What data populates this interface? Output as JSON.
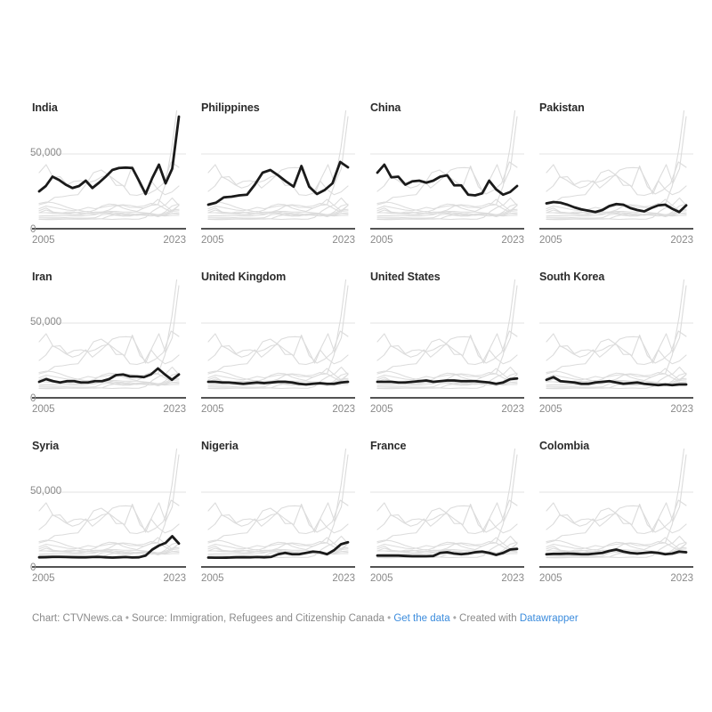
{
  "footer": {
    "chart_credit": "Chart: CTVNews.ca",
    "sep1": "•",
    "source": "Source: Immigration, Refugees and Citizenship Canada",
    "sep2": "•",
    "get_data_link": "Get the data",
    "sep3": "•",
    "created_with_prefix": "Created with",
    "created_with_link": "Datawrapper"
  },
  "axis": {
    "y_ticks": [
      "50,000",
      "0"
    ],
    "x_tick_left": "2005",
    "x_tick_right": "2023"
  },
  "colors": {
    "highlight_line": "#1a1a1a",
    "context_line": "#dcdcdc",
    "gridline": "#e3e3e3",
    "axis_line": "#1a1a1a",
    "tick_text": "#8a8a8a",
    "title_text": "#2b2b2b",
    "link": "#3b8cdd",
    "background": "#ffffff"
  },
  "chart_data": {
    "type": "line",
    "title": "",
    "subtitle": "",
    "xlabel": "",
    "ylabel": "",
    "grid": true,
    "legend_position": "none",
    "layout": "small-multiples 4 x 3",
    "ylim": [
      0,
      78000
    ],
    "y_tick_values": [
      0,
      50000
    ],
    "xlim": [
      2003,
      2023
    ],
    "x_tick_values": [
      2005,
      2023
    ],
    "x": [
      2003,
      2004,
      2005,
      2006,
      2007,
      2008,
      2009,
      2010,
      2011,
      2012,
      2013,
      2014,
      2015,
      2016,
      2017,
      2018,
      2019,
      2020,
      2021,
      2022,
      2023
    ],
    "panels": [
      {
        "name": "India",
        "row": 0,
        "col": 0,
        "values": [
          22000,
          26000,
          33000,
          30500,
          27000,
          24500,
          26000,
          30000,
          24500,
          28500,
          33000,
          38000,
          39500,
          39800,
          39500,
          30000,
          20000,
          32000,
          42000,
          28000,
          39000,
          78000
        ]
      },
      {
        "name": "Philippines",
        "row": 0,
        "col": 1,
        "values": [
          12000,
          13500,
          17500,
          18000,
          19000,
          19500,
          27000,
          36000,
          38000,
          34000,
          29500,
          25500,
          41000,
          25500,
          20000,
          23000,
          28000,
          44000,
          40000
        ]
      },
      {
        "name": "China",
        "row": 0,
        "col": 2,
        "values": [
          36000,
          42000,
          32500,
          33000,
          27000,
          29500,
          30000,
          28500,
          30000,
          33000,
          34000,
          26500,
          26500,
          19500,
          19000,
          20500,
          30000,
          23500,
          19500,
          21500,
          26000
        ]
      },
      {
        "name": "Pakistan",
        "row": 0,
        "col": 3,
        "values": [
          13000,
          14000,
          13500,
          12000,
          10000,
          8500,
          7500,
          6500,
          8000,
          11000,
          12500,
          12000,
          9500,
          8000,
          7000,
          9500,
          11500,
          12000,
          9000,
          6500,
          11500
        ]
      },
      {
        "name": "Iran",
        "row": 1,
        "col": 0,
        "values": [
          6000,
          8000,
          6500,
          5500,
          6500,
          6500,
          5500,
          5500,
          6500,
          6500,
          8000,
          11000,
          11500,
          10000,
          10000,
          9500,
          11500,
          16000,
          11500,
          7500,
          11500
        ]
      },
      {
        "name": "United Kingdom",
        "row": 1,
        "col": 1,
        "values": [
          6000,
          6000,
          5500,
          5500,
          5000,
          4500,
          5000,
          5500,
          5000,
          5500,
          6000,
          6000,
          5500,
          4500,
          4000,
          4500,
          5000,
          4500,
          4500,
          5500,
          6000
        ]
      },
      {
        "name": "United States",
        "row": 1,
        "col": 2,
        "values": [
          6000,
          6000,
          6000,
          5500,
          5500,
          6000,
          6500,
          7000,
          6000,
          6500,
          7000,
          7000,
          6500,
          6500,
          6500,
          6000,
          5500,
          4500,
          5500,
          8000,
          8500
        ]
      },
      {
        "name": "South Korea",
        "row": 1,
        "col": 3,
        "values": [
          7500,
          9500,
          6500,
          6000,
          5500,
          4500,
          4500,
          5500,
          6000,
          6500,
          5500,
          4500,
          5000,
          5500,
          4500,
          4000,
          3500,
          4000,
          3500,
          4000,
          4000
        ]
      },
      {
        "name": "Syria",
        "row": 2,
        "col": 0,
        "values": [
          1200,
          1300,
          1500,
          1500,
          1400,
          1300,
          1200,
          1200,
          1400,
          1500,
          1200,
          1000,
          1200,
          1400,
          1100,
          1200,
          2500,
          7000,
          10000,
          12000,
          17000,
          11500
        ]
      },
      {
        "name": "Nigeria",
        "row": 2,
        "col": 1,
        "values": [
          1000,
          900,
          900,
          1000,
          1200,
          1300,
          1200,
          1400,
          1200,
          1500,
          3500,
          4500,
          3500,
          3500,
          4500,
          5500,
          5000,
          3500,
          6500,
          11000,
          12500
        ]
      },
      {
        "name": "France",
        "row": 2,
        "col": 2,
        "values": [
          2500,
          2500,
          2500,
          2500,
          2200,
          2000,
          2000,
          2000,
          2200,
          4500,
          5000,
          4000,
          3500,
          4000,
          5000,
          5500,
          4500,
          3000,
          4500,
          7000,
          7500
        ]
      },
      {
        "name": "Colombia",
        "row": 2,
        "col": 3,
        "values": [
          3500,
          3800,
          3800,
          4000,
          3800,
          3500,
          3500,
          4000,
          4500,
          6000,
          7000,
          5500,
          4500,
          4000,
          4500,
          5000,
          4500,
          3500,
          4000,
          5500,
          5000
        ]
      }
    ],
    "context_series_note": "Each panel repeats all 12 country series in light gray; the panel's own country is drawn in bold black, plus one very tall light series rising off-scale at the right edge."
  }
}
